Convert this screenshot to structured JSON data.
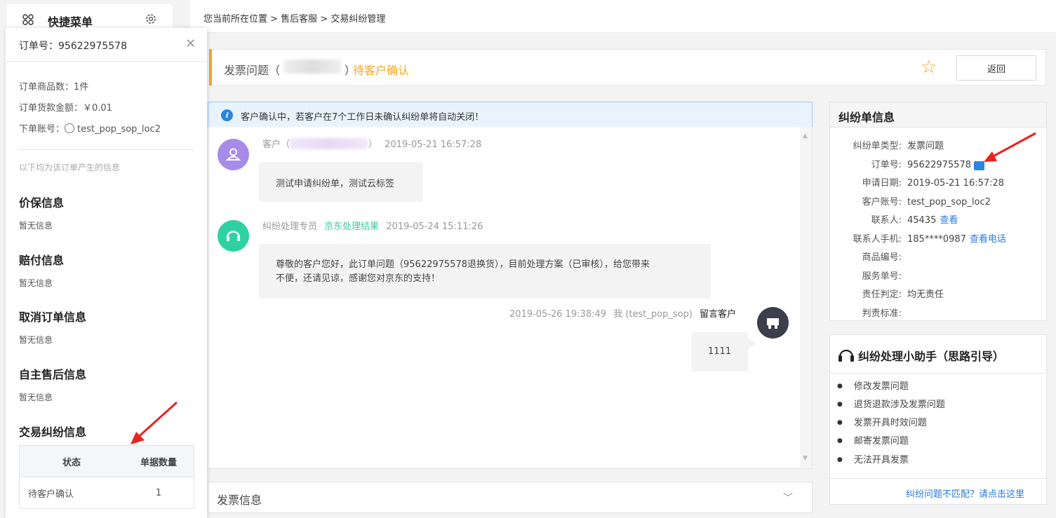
{
  "quick_menu": {
    "title": "快捷菜单"
  },
  "order_panel": {
    "order_no": "订单号：95622975578",
    "item_count": "订单商品数：1件",
    "amount": "订单货款金额：￥0.01",
    "account_label": "下单账号：",
    "account": "test_pop_sop_loc2",
    "note": "以下均为该订单产生的信息",
    "sections": [
      {
        "title": "价保信息",
        "value": "暂无信息"
      },
      {
        "title": "赔付信息",
        "value": "暂无信息"
      },
      {
        "title": "取消订单信息",
        "value": "暂无信息"
      },
      {
        "title": "自主售后信息",
        "value": "暂无信息"
      }
    ],
    "dispute_title": "交易纠纷信息",
    "table": {
      "headers": [
        "状态",
        "单据数量"
      ],
      "rows": [
        {
          "status": "待客户确认",
          "count": "1"
        }
      ]
    }
  },
  "breadcrumb": {
    "prefix": "您当前所在位置 > ",
    "level1": "售后客服",
    "sep": " > ",
    "level2": "交易纠纷管理"
  },
  "title_bar": {
    "type": "发票问题（",
    "close_paren": "）",
    "status": "待客户确认",
    "back_label": "返回"
  },
  "notice": {
    "text": "客户确认中，若客户在7个工作日未确认纠纷单将自动关闭！"
  },
  "chat": {
    "messages": [
      {
        "sender": "客户（",
        "close": "）",
        "time": "2019-05-21 16:57:28",
        "text": "测试申请纠纷单，测试云标签"
      },
      {
        "sender": "纠纷处理专员",
        "tag": "京东处理结果",
        "time": "2019-05-24 15:11:26",
        "text_line1": "尊敬的客户您好，此订单问题（95622975578退换货），目前处理方案（已审核），给您带来",
        "text_line2": "不便，还请见谅，感谢您对京东的支持！"
      },
      {
        "time": "2019-05-26 19:38:49",
        "who": "我 (test_pop_sop)",
        "action": "留言客户",
        "text": "1111"
      }
    ]
  },
  "dispute_info": {
    "title": "纠纷单信息",
    "fields": [
      {
        "k": "纠纷单类型:",
        "v": "发票问题"
      },
      {
        "k": "订单号:",
        "v": "95622975578"
      },
      {
        "k": "申请日期:",
        "v": "2019-05-21 16:57:28"
      },
      {
        "k": "客户账号:",
        "v": "test_pop_sop_loc2"
      },
      {
        "k": "联系人:",
        "v": "45435",
        "link": "查看"
      },
      {
        "k": "联系人手机:",
        "v": "185****0987",
        "link": "查看电话"
      },
      {
        "k": "商品编号:",
        "v": ""
      },
      {
        "k": "服务单号:",
        "v": ""
      },
      {
        "k": "责任判定:",
        "v": "均无责任"
      },
      {
        "k": "判责标准:",
        "v": ""
      }
    ]
  },
  "assistant": {
    "title": "纠纷处理小助手（思路引导）",
    "items": [
      "修改发票问题",
      "退货退款涉及发票问题",
      "发票开具时效问题",
      "邮寄发票问题",
      "无法开具发票"
    ],
    "mismatch": "纠纷问题不匹配？请点击这里"
  },
  "invoice": {
    "title": "发票信息"
  },
  "colors": {
    "accent_blue": "#2a7ae2",
    "status_orange": "#f5a623",
    "green_tag": "#3cc9a0",
    "arrow_red": "#e8231f"
  }
}
